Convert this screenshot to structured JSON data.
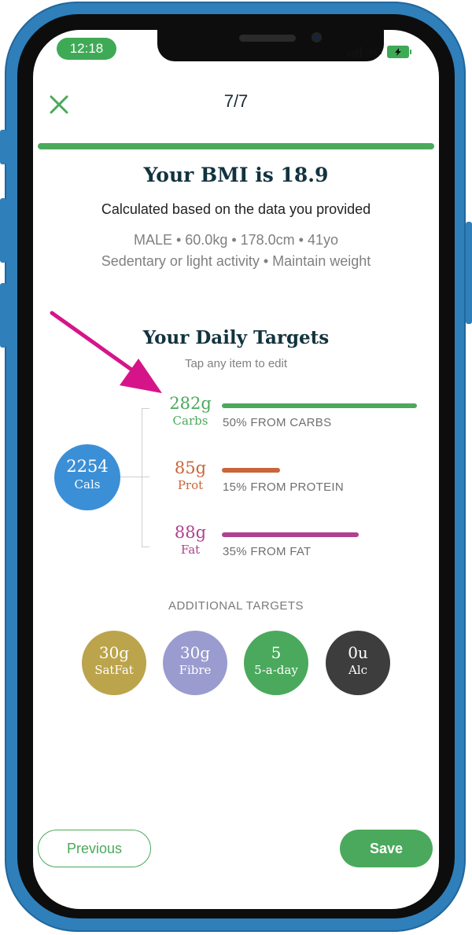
{
  "status_bar": {
    "time": "12:18",
    "network": "4G"
  },
  "header": {
    "step": "7/7"
  },
  "progress": {
    "fraction": 1.0
  },
  "bmi": {
    "title": "Your BMI is 18.9",
    "subtitle": "Calculated based on the data you provided",
    "profile": "MALE • 60.0kg • 178.0cm • 41yo",
    "activity": "Sedentary or light activity • Maintain weight"
  },
  "targets": {
    "title": "Your Daily Targets",
    "hint": "Tap any item to edit",
    "calories": {
      "value": "2254",
      "label": "Cals",
      "color": "#3b8fd6"
    },
    "macros": [
      {
        "value": "282g",
        "label": "Carbs",
        "bar_label": "50% FROM CARBS",
        "percent": 50,
        "color": "#4aa95c"
      },
      {
        "value": "85g",
        "label": "Prot",
        "bar_label": "15% FROM PROTEIN",
        "percent": 15,
        "color": "#c8663a"
      },
      {
        "value": "88g",
        "label": "Fat",
        "bar_label": "35% FROM FAT",
        "percent": 35,
        "color": "#b0418f"
      }
    ]
  },
  "additional": {
    "title": "ADDITIONAL TARGETS",
    "items": [
      {
        "value": "30g",
        "label": "SatFat",
        "color": "#bba44b"
      },
      {
        "value": "30g",
        "label": "Fibre",
        "color": "#9a9ccf"
      },
      {
        "value": "5",
        "label": "5-a-day",
        "color": "#4aa95c"
      },
      {
        "value": "0u",
        "label": "Alc",
        "color": "#3d3d3d"
      }
    ]
  },
  "footer": {
    "previous_label": "Previous",
    "save_label": "Save"
  },
  "colors": {
    "accent": "#4aa95c",
    "annotation_arrow": "#d6148a",
    "device": "#2f7fba"
  }
}
